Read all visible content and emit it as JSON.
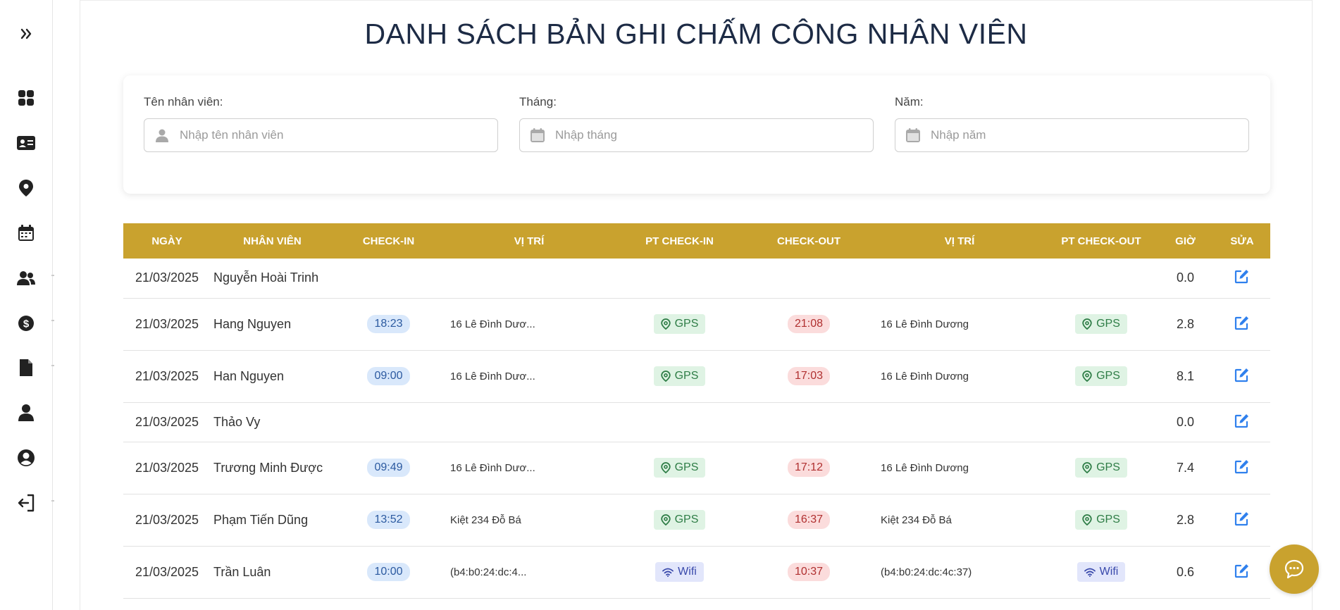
{
  "page": {
    "title": "DANH SÁCH BẢN GHI CHẤM CÔNG NHÂN VIÊN"
  },
  "sidebar": {
    "items": [
      {
        "icon": "expand-icon"
      },
      {
        "icon": "dashboard-icon"
      },
      {
        "icon": "id-card-icon"
      },
      {
        "icon": "location-icon"
      },
      {
        "icon": "calendar-icon"
      },
      {
        "icon": "users-icon"
      },
      {
        "icon": "dollar-icon"
      },
      {
        "icon": "document-icon"
      },
      {
        "icon": "user-icon"
      },
      {
        "icon": "user-circle-icon"
      },
      {
        "icon": "logout-icon"
      }
    ]
  },
  "filters": {
    "employee": {
      "label": "Tên nhân viên:",
      "placeholder": "Nhập tên nhân viên",
      "value": ""
    },
    "month": {
      "label": "Tháng:",
      "placeholder": "Nhập tháng",
      "value": ""
    },
    "year": {
      "label": "Năm:",
      "placeholder": "Nhập năm",
      "value": ""
    }
  },
  "table": {
    "headers": [
      "NGÀY",
      "NHÂN VIÊN",
      "CHECK-IN",
      "VỊ TRÍ",
      "PT CHECK-IN",
      "CHECK-OUT",
      "VỊ TRÍ",
      "PT CHECK-OUT",
      "GIỜ",
      "SỬA"
    ],
    "rows": [
      {
        "date": "21/03/2025",
        "name": "Nguyễn Hoài Trinh",
        "checkin": "",
        "loc_in": "",
        "method_in": "",
        "checkout": "",
        "loc_out": "",
        "method_out": "",
        "hours": "0.0"
      },
      {
        "date": "21/03/2025",
        "name": "Hang Nguyen",
        "checkin": "18:23",
        "loc_in": "16 Lê Đình Dươ...",
        "method_in": "GPS",
        "checkout": "21:08",
        "loc_out": "16 Lê Đình Dương",
        "method_out": "GPS",
        "hours": "2.8"
      },
      {
        "date": "21/03/2025",
        "name": "Han Nguyen",
        "checkin": "09:00",
        "loc_in": "16 Lê Đình Dươ...",
        "method_in": "GPS",
        "checkout": "17:03",
        "loc_out": "16 Lê Đình Dương",
        "method_out": "GPS",
        "hours": "8.1"
      },
      {
        "date": "21/03/2025",
        "name": "Thảo Vy",
        "checkin": "",
        "loc_in": "",
        "method_in": "",
        "checkout": "",
        "loc_out": "",
        "method_out": "",
        "hours": "0.0"
      },
      {
        "date": "21/03/2025",
        "name": "Trương Minh Được",
        "checkin": "09:49",
        "loc_in": "16 Lê Đình Dươ...",
        "method_in": "GPS",
        "checkout": "17:12",
        "loc_out": "16 Lê Đình Dương",
        "method_out": "GPS",
        "hours": "7.4"
      },
      {
        "date": "21/03/2025",
        "name": "Phạm Tiến Dũng",
        "checkin": "13:52",
        "loc_in": "Kiệt 234 Đỗ Bá",
        "method_in": "GPS",
        "checkout": "16:37",
        "loc_out": "Kiệt 234 Đỗ Bá",
        "method_out": "GPS",
        "hours": "2.8"
      },
      {
        "date": "21/03/2025",
        "name": "Trần Luân",
        "checkin": "10:00",
        "loc_in": "(b4:b0:24:dc:4...",
        "method_in": "Wifi",
        "checkout": "10:37",
        "loc_out": "(b4:b0:24:dc:4c:37)",
        "method_out": "Wifi",
        "hours": "0.6"
      }
    ]
  },
  "colors": {
    "accent": "#c9a22e",
    "edit": "#2f80ed"
  }
}
